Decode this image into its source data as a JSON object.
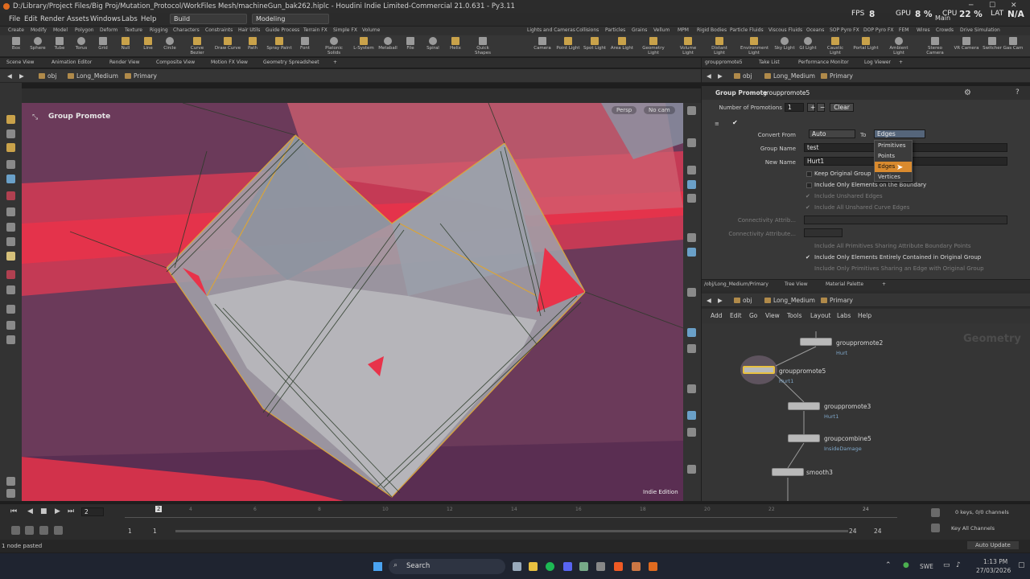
{
  "window": {
    "title": "D:/Library/Project Files/Big Proj/Mutation_Protocol/WorkFiles Mesh/machineGun_bak262.hiplc - Houdini Indie Limited-Commercial 21.0.631 - Py3.11",
    "menu": [
      "File",
      "Edit",
      "Render",
      "Assets",
      "Windows",
      "Labs",
      "Help"
    ],
    "desktops": [
      "Build",
      "Modeling"
    ],
    "main_label": "Main",
    "stats": {
      "fps_label": "FPS",
      "fps_value": "8",
      "gpu_label": "GPU",
      "gpu_value": "8 %",
      "cpu_label": "CPU",
      "cpu_value": "22 %",
      "lat_label": "LAT",
      "lat_value": "N/A"
    }
  },
  "shelf_tabs_left": [
    "Create",
    "Modify",
    "Model",
    "Polygon",
    "Deform",
    "Texture",
    "Rigging",
    "Characters",
    "Constraints",
    "Hair Utils",
    "Guide Process",
    "Terrain FX",
    "Simple FX",
    "Volume"
  ],
  "shelf_tabs_right": [
    "Lights and Cameras",
    "Collisions",
    "Particles",
    "Grains",
    "Vellum",
    "MPM",
    "Rigid Bodies",
    "Particle Fluids",
    "Viscous Fluids",
    "Oceans",
    "SOP Pyro FX",
    "DOP Pyro FX",
    "FEM",
    "Wires",
    "Crowds",
    "Drive Simulation"
  ],
  "shelf_tools_left": [
    "Box",
    "Sphere",
    "Tube",
    "Torus",
    "Grid",
    "Null",
    "Line",
    "Circle",
    "Curve Bezier",
    "Draw Curve",
    "Path",
    "Spray Paint",
    "Font",
    "Platonic Solids",
    "L-System",
    "Metaball",
    "File",
    "Spiral",
    "Helix",
    "Quick Shapes"
  ],
  "shelf_tools_right": [
    "Camera",
    "Point Light",
    "Spot Light",
    "Area Light",
    "Geometry Light",
    "Volume Light",
    "Distant Light",
    "Environment Light",
    "Sky Light",
    "GI Light",
    "Caustic Light",
    "Portal Light",
    "Ambient Light",
    "Stereo Camera",
    "VR Camera",
    "Switcher",
    "Gas Cam"
  ],
  "left_pane_tabs": [
    "Scene View",
    "Animation Editor",
    "Render View",
    "Composite View",
    "Motion FX View",
    "Geometry Spreadsheet"
  ],
  "right_pane_tabs": [
    "grouppromote5",
    "Take List",
    "Performance Monitor",
    "Log Viewer"
  ],
  "path": {
    "obj": "obj",
    "geo": "Long_Medium",
    "ctx": "Primary"
  },
  "viewport": {
    "label": "Group Promote",
    "persp": "Persp",
    "cam": "No cam",
    "edition": "Indie Edition"
  },
  "params": {
    "node_type": "Group Promote",
    "node_name": "grouppromote5",
    "num_promotions_label": "Number of Promotions",
    "num_promotions": "1",
    "clear_label": "Clear",
    "convert_from_label": "Convert From",
    "convert_from": "Auto",
    "to_label": "To",
    "to_value": "Edges",
    "group_name_label": "Group Name",
    "group_name": "test",
    "new_name_label": "New Name",
    "new_name": "Hurt1",
    "keep_original": "Keep Original Group",
    "boundary": "Include Only Elements on the Boundary",
    "unshared_edges": "Include Unshared Edges",
    "unshared_curve": "Include All Unshared Curve Edges",
    "conn_attr1": "Connectivity Attrib...",
    "conn_attr2": "Connectivity Attribute...",
    "sharing_attr": "Include All Primitives Sharing Attribute Boundary Points",
    "entirely": "Include Only Elements Entirely Contained in Original Group",
    "sharing_edge": "Include Only Primitives Sharing an Edge with Original Group",
    "dropdown": [
      "Primitives",
      "Points",
      "Edges",
      "Vertices"
    ]
  },
  "net_tabs": [
    "/obj/Long_Medium/Primary",
    "Tree View",
    "Material Palette"
  ],
  "net_menu": [
    "Add",
    "Edit",
    "Go",
    "View",
    "Tools",
    "Layout",
    "Labs",
    "Help"
  ],
  "net_watermark": "Geometry",
  "nodes": [
    {
      "name": "grouppromote2",
      "sub": "Hurt"
    },
    {
      "name": "grouppromote5",
      "sub": "Hurt1"
    },
    {
      "name": "grouppromote3",
      "sub": "Hurt1"
    },
    {
      "name": "groupcombine5",
      "sub": "InsideDamage"
    },
    {
      "name": "smooth3",
      "sub": ""
    }
  ],
  "timeline": {
    "frame": "2",
    "ticks": [
      "2",
      "12",
      "18",
      "24"
    ],
    "marks": [
      "4",
      "6",
      "8",
      "10",
      "12",
      "14",
      "16",
      "18",
      "20",
      "22",
      "24"
    ],
    "start": "1",
    "start2": "1",
    "end": "24",
    "end2": "24",
    "keys": "0 keys, 0/0 channels",
    "key_all": "Key All Channels",
    "auto_update": "Auto Update"
  },
  "status": "1 node pasted",
  "taskbar": {
    "search": "Search",
    "lang": "SWE",
    "time": "1:13 PM",
    "date": "27/03/2026"
  },
  "colors": {
    "accent": "#d98a2e",
    "viewport_bg": "#6b3a5a",
    "stripe": "#e8334a"
  }
}
